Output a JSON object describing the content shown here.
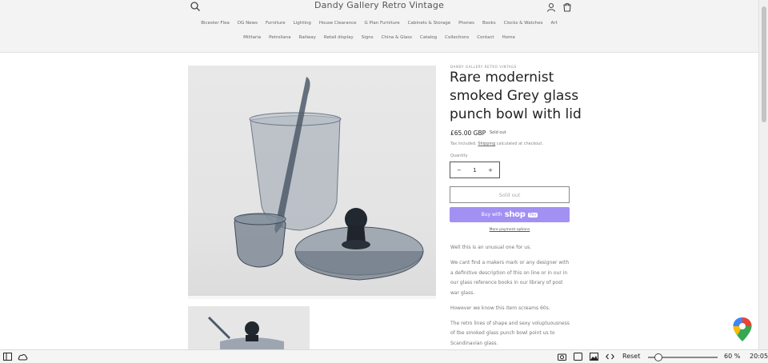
{
  "header": {
    "brand": "Dandy Gallery Retro Vintage",
    "nav_row1": [
      "Bicester Flea",
      "DG News",
      "Furniture",
      "Lighting",
      "House Clearance",
      "G Plan Furniture",
      "Cabinets & Storage",
      "Phones",
      "Books",
      "Clocks & Watches",
      "Art"
    ],
    "nav_row2": [
      "Militaria",
      "Petroliana",
      "Railway",
      "Retail display",
      "Signs",
      "China & Glass",
      "Catalog",
      "Collections",
      "Contact",
      "Home"
    ]
  },
  "product": {
    "vendor": "DANDY GALLERY RETRO VINTAGE",
    "title": "Rare modernist smoked Grey glass punch bowl with lid",
    "price": "£65.00 GBP",
    "badge": "Sold out",
    "tax_prefix": "Tax included.",
    "tax_link": "Shipping",
    "tax_suffix": "calculated at checkout.",
    "quantity_label": "Quantity",
    "quantity_minus": "−",
    "quantity_value": "1",
    "quantity_plus": "+",
    "sold_out_button": "Sold out",
    "buy_with": "Buy with",
    "shop_logo": "shop",
    "pay_tag": "Pay",
    "more_payment": "More payment options",
    "description": [
      "Well this is an unusual one for us.",
      "We cant find a makers mark or any designer with a definitive description of this on line or in our in our glass reference books in our library of post war glass.",
      "However we know this item screams 60s.",
      "The retro lines of shape and sexy voluptuousness of tbe smoked glass punch bowl point us to Scandinavian glass."
    ]
  },
  "taskbar": {
    "reset": "Reset",
    "zoom": "60 %",
    "zoom_level": 0.1,
    "time": "20:05"
  },
  "icons": {
    "search": "search-icon",
    "account": "account-icon",
    "cart": "cart-icon",
    "maps": "maps-pin-icon"
  },
  "colors": {
    "shop_pay": "#a291f3",
    "header_bg": "#f3f3f3"
  }
}
